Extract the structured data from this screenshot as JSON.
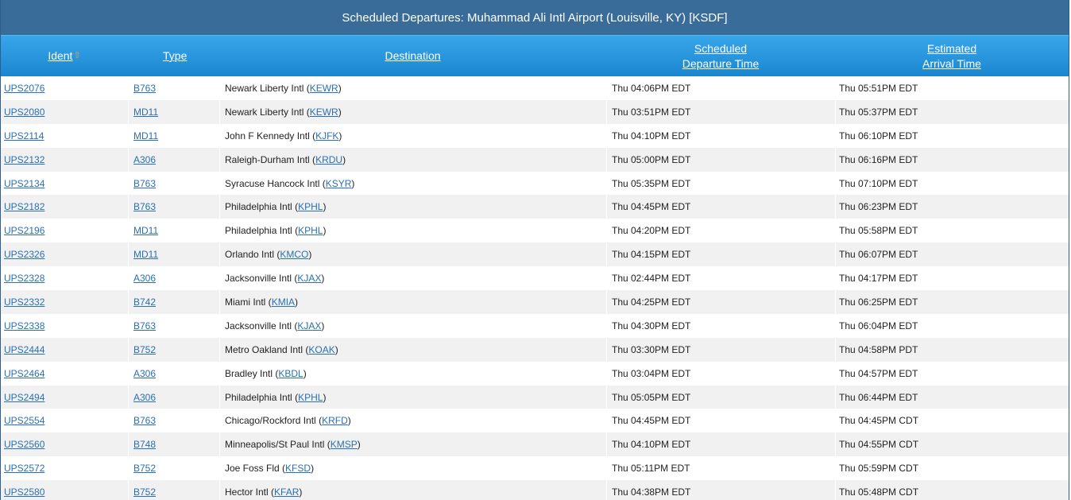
{
  "title": "Scheduled Departures: Muhammad Ali Intl Airport (Louisville, KY) [KSDF]",
  "columns": {
    "ident": "Ident",
    "type": "Type",
    "destination": "Destination",
    "departure_line1": "Scheduled",
    "departure_line2": "Departure Time",
    "arrival_line1": "Estimated",
    "arrival_line2": "Arrival Time"
  },
  "sort_icon": "sort-ascending-icon",
  "rows": [
    {
      "ident": "UPS2076",
      "type": "B763",
      "dest_name": "Newark Liberty Intl",
      "dest_code": "KEWR",
      "departure": "Thu 04:06PM EDT",
      "arrival": "Thu 05:51PM EDT"
    },
    {
      "ident": "UPS2080",
      "type": "MD11",
      "dest_name": "Newark Liberty Intl",
      "dest_code": "KEWR",
      "departure": "Thu 03:51PM EDT",
      "arrival": "Thu 05:37PM EDT"
    },
    {
      "ident": "UPS2114",
      "type": "MD11",
      "dest_name": "John F Kennedy Intl",
      "dest_code": "KJFK",
      "departure": "Thu 04:10PM EDT",
      "arrival": "Thu 06:10PM EDT"
    },
    {
      "ident": "UPS2132",
      "type": "A306",
      "dest_name": "Raleigh-Durham Intl",
      "dest_code": "KRDU",
      "departure": "Thu 05:00PM EDT",
      "arrival": "Thu 06:16PM EDT"
    },
    {
      "ident": "UPS2134",
      "type": "B763",
      "dest_name": "Syracuse Hancock Intl",
      "dest_code": "KSYR",
      "departure": "Thu 05:35PM EDT",
      "arrival": "Thu 07:10PM EDT"
    },
    {
      "ident": "UPS2182",
      "type": "B763",
      "dest_name": "Philadelphia Intl",
      "dest_code": "KPHL",
      "departure": "Thu 04:45PM EDT",
      "arrival": "Thu 06:23PM EDT"
    },
    {
      "ident": "UPS2196",
      "type": "MD11",
      "dest_name": "Philadelphia Intl",
      "dest_code": "KPHL",
      "departure": "Thu 04:20PM EDT",
      "arrival": "Thu 05:58PM EDT"
    },
    {
      "ident": "UPS2326",
      "type": "MD11",
      "dest_name": "Orlando Intl",
      "dest_code": "KMCO",
      "departure": "Thu 04:15PM EDT",
      "arrival": "Thu 06:07PM EDT"
    },
    {
      "ident": "UPS2328",
      "type": "A306",
      "dest_name": "Jacksonville Intl",
      "dest_code": "KJAX",
      "departure": "Thu 02:44PM EDT",
      "arrival": "Thu 04:17PM EDT"
    },
    {
      "ident": "UPS2332",
      "type": "B742",
      "dest_name": "Miami Intl",
      "dest_code": "KMIA",
      "departure": "Thu 04:25PM EDT",
      "arrival": "Thu 06:25PM EDT"
    },
    {
      "ident": "UPS2338",
      "type": "B763",
      "dest_name": "Jacksonville Intl",
      "dest_code": "KJAX",
      "departure": "Thu 04:30PM EDT",
      "arrival": "Thu 06:04PM EDT"
    },
    {
      "ident": "UPS2444",
      "type": "B752",
      "dest_name": "Metro Oakland Intl",
      "dest_code": "KOAK",
      "departure": "Thu 03:30PM EDT",
      "arrival": "Thu 04:58PM PDT"
    },
    {
      "ident": "UPS2464",
      "type": "A306",
      "dest_name": "Bradley Intl",
      "dest_code": "KBDL",
      "departure": "Thu 03:04PM EDT",
      "arrival": "Thu 04:57PM EDT"
    },
    {
      "ident": "UPS2494",
      "type": "A306",
      "dest_name": "Philadelphia Intl",
      "dest_code": "KPHL",
      "departure": "Thu 05:05PM EDT",
      "arrival": "Thu 06:44PM EDT"
    },
    {
      "ident": "UPS2554",
      "type": "B763",
      "dest_name": "Chicago/Rockford Intl",
      "dest_code": "KRFD",
      "departure": "Thu 04:45PM EDT",
      "arrival": "Thu 04:45PM CDT"
    },
    {
      "ident": "UPS2560",
      "type": "B748",
      "dest_name": "Minneapolis/St Paul Intl",
      "dest_code": "KMSP",
      "departure": "Thu 04:10PM EDT",
      "arrival": "Thu 04:55PM CDT"
    },
    {
      "ident": "UPS2572",
      "type": "B752",
      "dest_name": "Joe Foss Fld",
      "dest_code": "KFSD",
      "departure": "Thu 05:11PM EDT",
      "arrival": "Thu 05:59PM CDT"
    },
    {
      "ident": "UPS2580",
      "type": "B752",
      "dest_name": "Hector Intl",
      "dest_code": "KFAR",
      "departure": "Thu 04:38PM EDT",
      "arrival": "Thu 05:48PM CDT"
    }
  ]
}
